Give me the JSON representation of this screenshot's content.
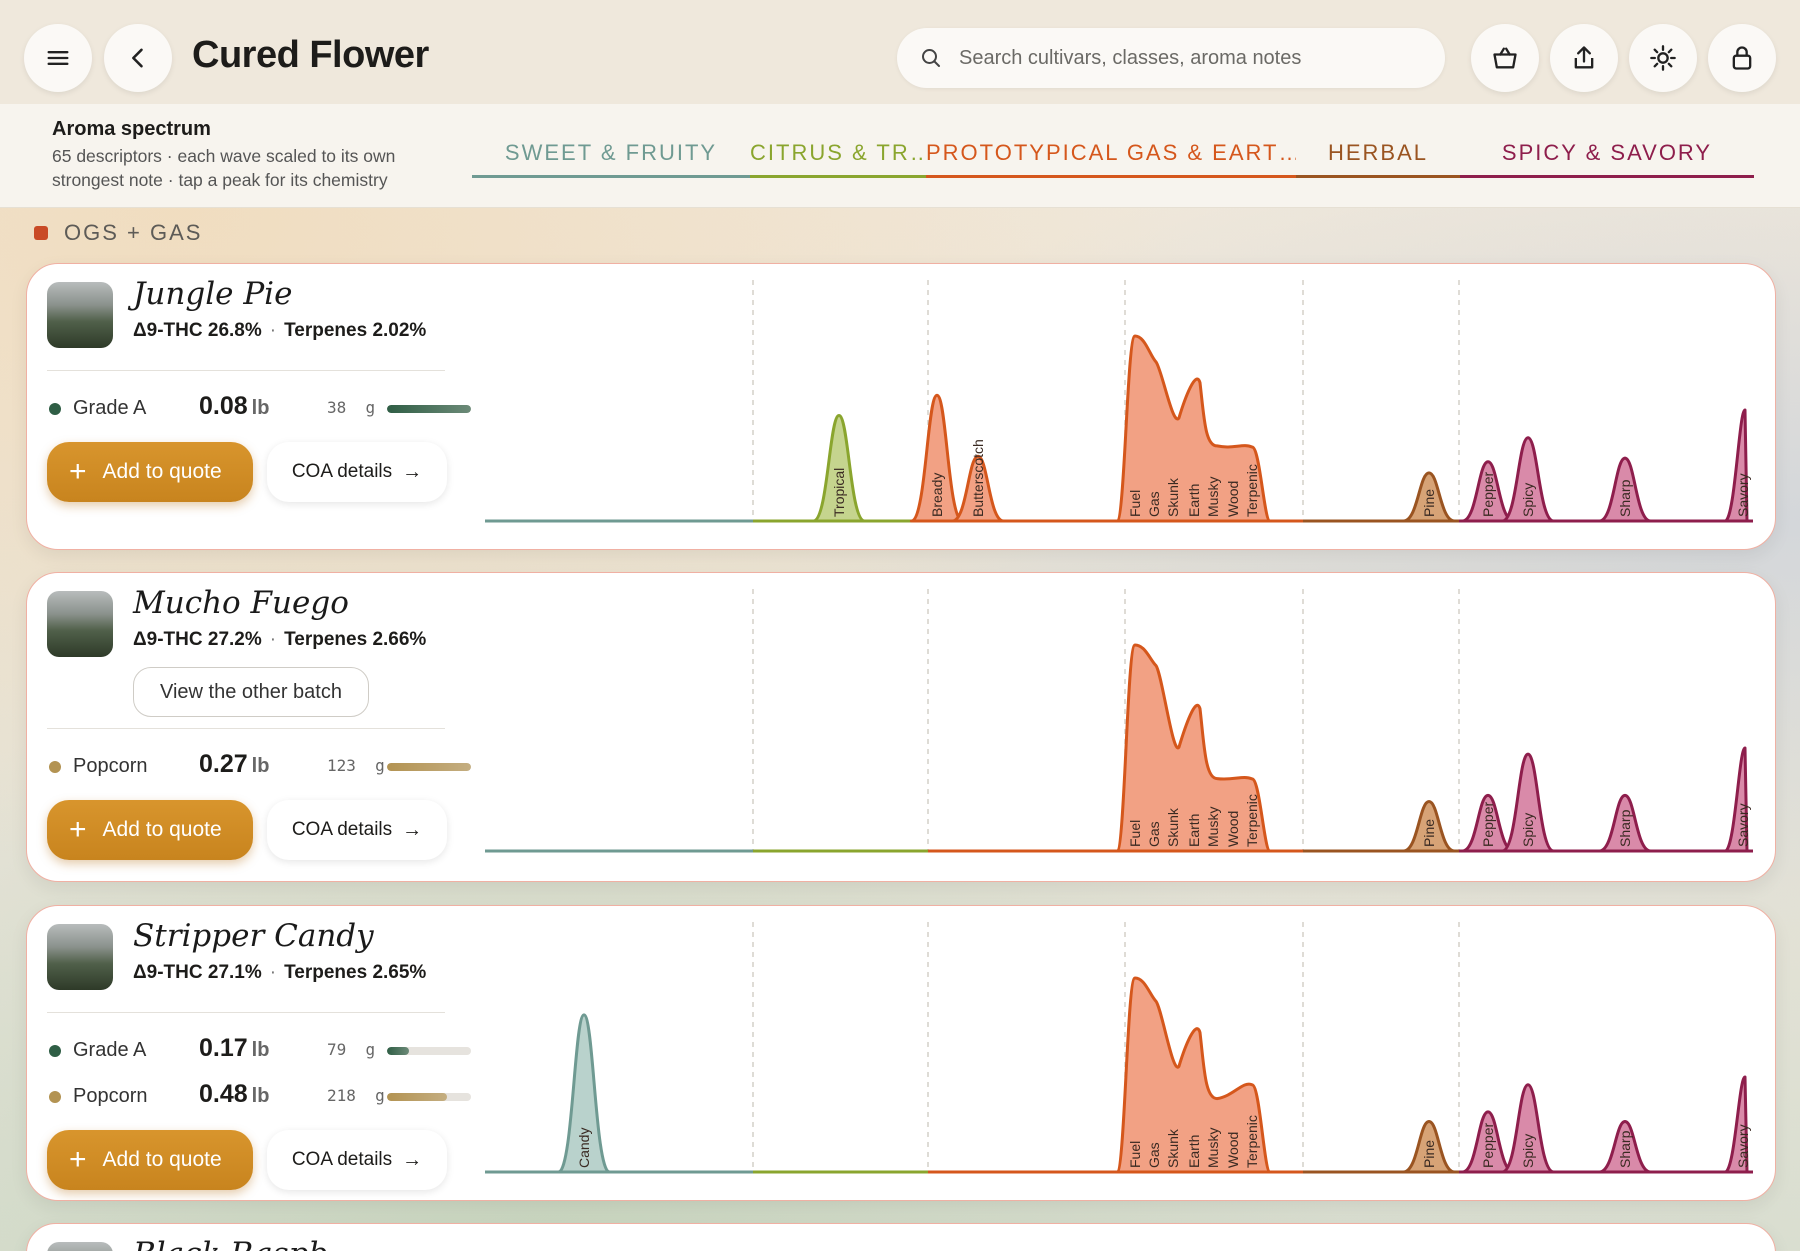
{
  "header": {
    "title": "Cured Flower",
    "search_placeholder": "Search cultivars, classes, aroma notes"
  },
  "spectrum": {
    "title": "Aroma spectrum",
    "subtitle": "65 descriptors · each wave scaled to its own strongest note · tap a peak for its chemistry",
    "families": [
      {
        "label": "SWEET & FRUITY",
        "color": "#6f9a92"
      },
      {
        "label": "CITRUS & TR…",
        "color": "#8aa52e"
      },
      {
        "label": "PROTOTYPICAL GAS & EART…",
        "color": "#d5571c"
      },
      {
        "label": "HERBAL",
        "color": "#9a5421"
      },
      {
        "label": "SPICY & SAVORY",
        "color": "#8e1e4c"
      }
    ]
  },
  "section": {
    "label": "OGS + GAS",
    "color": "#c94a26"
  },
  "labels": {
    "add_to_quote": "Add to quote",
    "coa_details": "COA details",
    "view_other_batch": "View the other batch",
    "grams_unit": "g",
    "pounds_unit": "lb"
  },
  "cards": [
    {
      "name": "Jungle Pie",
      "thc": "Δ9-THC 26.8%",
      "terpenes": "Terpenes 2.02%",
      "grades": [
        {
          "label": "Grade A",
          "lb": "0.08",
          "g": "38",
          "fill": 1.0,
          "color": "#2f5e45"
        }
      ],
      "peaks": [
        {
          "label": "Tropical",
          "family": 1,
          "height": 0.57
        },
        {
          "label": "Bready",
          "family": 2,
          "height": 0.68
        },
        {
          "label": "Butterscotch",
          "family": 2,
          "height": 0.35
        },
        {
          "label": "Fuel",
          "family": 2,
          "height": 1.0
        },
        {
          "label": "Gas",
          "family": 2,
          "height": 0.86
        },
        {
          "label": "Skunk",
          "family": 2,
          "height": 0.72
        },
        {
          "label": "Earth",
          "family": 2,
          "height": 0.78
        },
        {
          "label": "Musky",
          "family": 2,
          "height": 0.46
        },
        {
          "label": "Wood",
          "family": 2,
          "height": 0.42
        },
        {
          "label": "Terpenic",
          "family": 2,
          "height": 0.4
        },
        {
          "label": "Pine",
          "family": 3,
          "height": 0.26
        },
        {
          "label": "Pepper",
          "family": 4,
          "height": 0.32
        },
        {
          "label": "Spicy",
          "family": 4,
          "height": 0.45
        },
        {
          "label": "Sharp",
          "family": 4,
          "height": 0.34
        },
        {
          "label": "Savory",
          "family": 4,
          "height": 0.6
        }
      ]
    },
    {
      "name": "Mucho Fuego",
      "thc": "Δ9-THC 27.2%",
      "terpenes": "Terpenes 2.66%",
      "grades": [
        {
          "label": "Popcorn",
          "lb": "0.27",
          "g": "123",
          "fill": 1.0,
          "color": "#b39352"
        }
      ],
      "peaks": [
        {
          "label": "Fuel",
          "family": 2,
          "height": 1.0
        },
        {
          "label": "Gas",
          "family": 2,
          "height": 0.9
        },
        {
          "label": "Skunk",
          "family": 2,
          "height": 0.65
        },
        {
          "label": "Earth",
          "family": 2,
          "height": 0.72
        },
        {
          "label": "Musky",
          "family": 2,
          "height": 0.4
        },
        {
          "label": "Wood",
          "family": 2,
          "height": 0.37
        },
        {
          "label": "Terpenic",
          "family": 2,
          "height": 0.35
        },
        {
          "label": "Pine",
          "family": 3,
          "height": 0.24
        },
        {
          "label": "Pepper",
          "family": 4,
          "height": 0.27
        },
        {
          "label": "Spicy",
          "family": 4,
          "height": 0.47
        },
        {
          "label": "Sharp",
          "family": 4,
          "height": 0.27
        },
        {
          "label": "Savory",
          "family": 4,
          "height": 0.5
        }
      ]
    },
    {
      "name": "Stripper Candy",
      "thc": "Δ9-THC 27.1%",
      "terpenes": "Terpenes 2.65%",
      "grades": [
        {
          "label": "Grade A",
          "lb": "0.17",
          "g": "79",
          "fill": 0.26,
          "color": "#2f5e45"
        },
        {
          "label": "Popcorn",
          "lb": "0.48",
          "g": "218",
          "fill": 0.72,
          "color": "#b39352"
        }
      ],
      "peaks": [
        {
          "label": "Candy",
          "family": 0,
          "height": 0.81
        },
        {
          "label": "Fuel",
          "family": 2,
          "height": 1.0
        },
        {
          "label": "Gas",
          "family": 2,
          "height": 0.88
        },
        {
          "label": "Skunk",
          "family": 2,
          "height": 0.7
        },
        {
          "label": "Earth",
          "family": 2,
          "height": 0.75
        },
        {
          "label": "Musky",
          "family": 2,
          "height": 0.43
        },
        {
          "label": "Wood",
          "family": 2,
          "height": 0.42
        },
        {
          "label": "Terpenic",
          "family": 2,
          "height": 0.45
        },
        {
          "label": "Pine",
          "family": 3,
          "height": 0.26
        },
        {
          "label": "Pepper",
          "family": 4,
          "height": 0.31
        },
        {
          "label": "Spicy",
          "family": 4,
          "height": 0.45
        },
        {
          "label": "Sharp",
          "family": 4,
          "height": 0.26
        },
        {
          "label": "Savory",
          "family": 4,
          "height": 0.49
        }
      ]
    },
    {
      "name": "Black Raspb…",
      "peaks": []
    }
  ]
}
